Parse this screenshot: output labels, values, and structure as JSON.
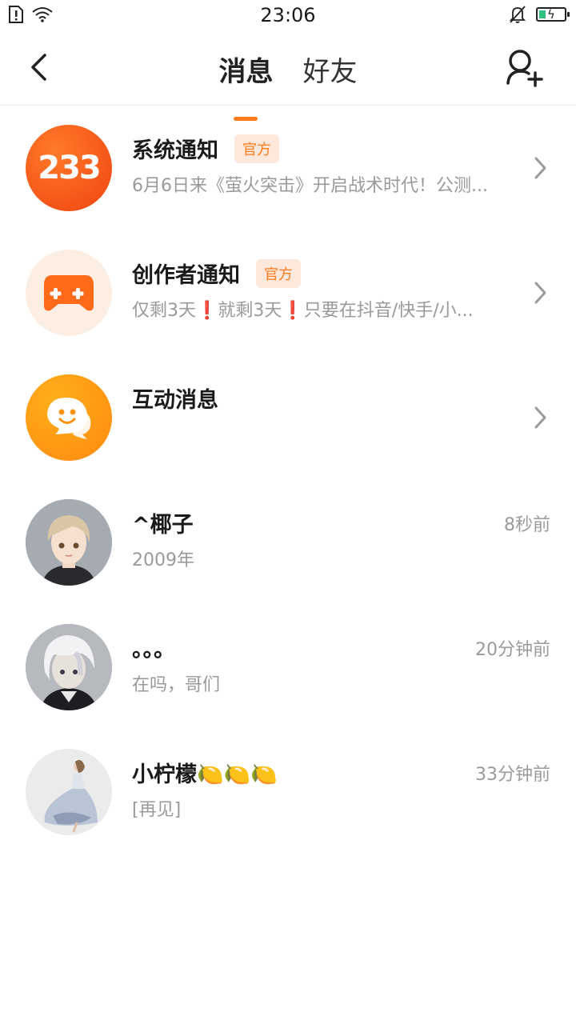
{
  "status_bar": {
    "time": "23:06",
    "icons": [
      "sim-alert-icon",
      "wifi-icon",
      "silent-bell-icon",
      "battery-charging-icon"
    ]
  },
  "header": {
    "tabs": [
      {
        "label": "消息",
        "active": true
      },
      {
        "label": "好友",
        "active": false
      }
    ],
    "accent_color": "#ff7a1a"
  },
  "messages": [
    {
      "title": "系统通知",
      "badge": "官方",
      "preview": "6月6日来《萤火突击》开启战术时代！公测...",
      "avatar_text": "233",
      "avatar_icon": "brand-233-logo",
      "has_chevron": true
    },
    {
      "title": "创作者通知",
      "badge": "官方",
      "preview": "仅剩3天❗就剩3天❗只要在抖音/快手/小...",
      "avatar_icon": "gamepad-plus-icon",
      "has_chevron": true
    },
    {
      "title": "互动消息",
      "preview": "",
      "avatar_icon": "chat-smile-icon",
      "has_chevron": true
    },
    {
      "title": "^椰子",
      "preview": "2009年",
      "time": "8秒前",
      "avatar_icon": "user-avatar-1"
    },
    {
      "title": "。。。",
      "preview": "在吗，哥们",
      "time": "20分钟前",
      "avatar_icon": "user-avatar-2"
    },
    {
      "title": "小柠檬🍋🍋🍋",
      "preview": "[再见]",
      "time": "33分钟前",
      "avatar_icon": "user-avatar-3"
    }
  ]
}
